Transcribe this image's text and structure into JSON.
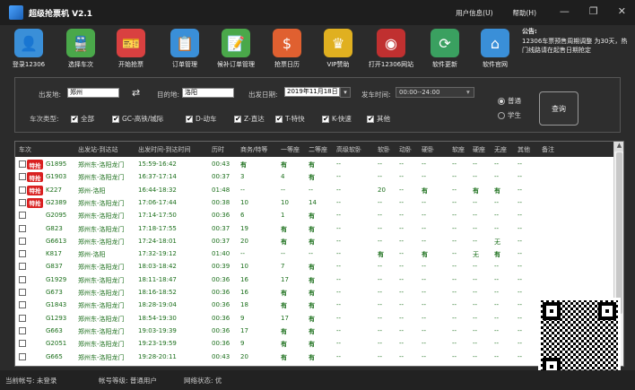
{
  "app": {
    "title": "超级抢票机 V2.1",
    "menus": [
      "用户信息(U)",
      "帮助(H)"
    ],
    "win_buttons": [
      "—",
      "❐",
      "✕"
    ]
  },
  "toolbar": [
    {
      "label": "登录12306",
      "icon": "user-icon",
      "color": "#3a8fd8",
      "glyph": "👤"
    },
    {
      "label": "选择车次",
      "icon": "train-icon",
      "color": "#4aa84a",
      "glyph": "🚆"
    },
    {
      "label": "开始抢票",
      "icon": "ticket-icon",
      "color": "#d94040",
      "glyph": "🎫"
    },
    {
      "label": "订单管理",
      "icon": "order-icon",
      "color": "#3a8fd8",
      "glyph": "📋"
    },
    {
      "label": "候补订单管理",
      "icon": "waitlist-icon",
      "color": "#4aa84a",
      "glyph": "📝"
    },
    {
      "label": "抢票日历",
      "icon": "calendar-icon",
      "color": "#e06030",
      "glyph": "$"
    },
    {
      "label": "VIP赞助",
      "icon": "vip-icon",
      "color": "#e0b020",
      "glyph": "♛"
    },
    {
      "label": "打开12306网站",
      "icon": "railway-logo-icon",
      "color": "#c03030",
      "glyph": "◉"
    },
    {
      "label": "软件更新",
      "icon": "refresh-icon",
      "color": "#3aa060",
      "glyph": "⟳"
    },
    {
      "label": "软件官网",
      "icon": "home-icon",
      "color": "#3a8fd8",
      "glyph": "⌂"
    }
  ],
  "notice": {
    "title": "公告:",
    "text": "12306车票预售周期调整 为30天，热门线路请在起售日期抢定"
  },
  "filter": {
    "from_label": "出发地:",
    "from_value": "郑州",
    "swap_glyph": "⇄",
    "to_label": "目的地:",
    "to_value": "洛阳",
    "date_label": "出发日期:",
    "date_value": "2019年11月18日",
    "time_label": "发车时间:",
    "time_value": "00:00--24:00",
    "type_label": "车次类型:",
    "types": [
      {
        "label": "全部",
        "checked": true
      },
      {
        "label": "GC-高铁/城际",
        "checked": true
      },
      {
        "label": "D-动车",
        "checked": true
      },
      {
        "label": "Z-直达",
        "checked": true
      },
      {
        "label": "T-特快",
        "checked": true
      },
      {
        "label": "K-快速",
        "checked": true
      },
      {
        "label": "其他",
        "checked": true
      }
    ],
    "passenger_types": [
      {
        "label": "普通",
        "checked": true
      },
      {
        "label": "学生",
        "checked": false
      }
    ],
    "query_label": "查询"
  },
  "table": {
    "headers": [
      "车次",
      "出发站-到达站",
      "出发时间-到达时间",
      "历时",
      "商务/特等",
      "一等座",
      "二等座",
      "高级软卧",
      "软卧",
      "动卧",
      "硬卧",
      "软座",
      "硬座",
      "无座",
      "其他",
      "备注"
    ],
    "badge_label": "特抢",
    "rows": [
      {
        "train": "G1895",
        "badge": true,
        "stations": "郑州东-洛阳龙门",
        "times": "15:59-16:42",
        "duration": "00:43",
        "c": [
          "有",
          "有",
          "有",
          "--",
          "--",
          "--",
          "--",
          "--",
          "--",
          "--",
          "--"
        ]
      },
      {
        "train": "G1903",
        "badge": true,
        "stations": "郑州东-洛阳龙门",
        "times": "16:37-17:14",
        "duration": "00:37",
        "c": [
          "3",
          "4",
          "有",
          "--",
          "--",
          "--",
          "--",
          "--",
          "--",
          "--",
          "--"
        ]
      },
      {
        "train": "K227",
        "badge": true,
        "stations": "郑州-洛阳",
        "times": "16:44-18:32",
        "duration": "01:48",
        "c": [
          "--",
          "--",
          "--",
          "--",
          "20",
          "--",
          "有",
          "--",
          "有",
          "有",
          "--"
        ]
      },
      {
        "train": "G2389",
        "badge": true,
        "stations": "郑州东-洛阳龙门",
        "times": "17:06-17:44",
        "duration": "00:38",
        "c": [
          "10",
          "10",
          "14",
          "--",
          "--",
          "--",
          "--",
          "--",
          "--",
          "--",
          "--"
        ]
      },
      {
        "train": "G2095",
        "badge": false,
        "stations": "郑州东-洛阳龙门",
        "times": "17:14-17:50",
        "duration": "00:36",
        "c": [
          "6",
          "1",
          "有",
          "--",
          "--",
          "--",
          "--",
          "--",
          "--",
          "--",
          "--"
        ]
      },
      {
        "train": "G823",
        "badge": false,
        "stations": "郑州东-洛阳龙门",
        "times": "17:18-17:55",
        "duration": "00:37",
        "c": [
          "19",
          "有",
          "有",
          "--",
          "--",
          "--",
          "--",
          "--",
          "--",
          "--",
          "--"
        ]
      },
      {
        "train": "G6613",
        "badge": false,
        "stations": "郑州东-洛阳龙门",
        "times": "17:24-18:01",
        "duration": "00:37",
        "c": [
          "20",
          "有",
          "有",
          "--",
          "--",
          "--",
          "--",
          "--",
          "--",
          "无",
          "--"
        ]
      },
      {
        "train": "K817",
        "badge": false,
        "stations": "郑州-洛阳",
        "times": "17:32-19:12",
        "duration": "01:40",
        "c": [
          "--",
          "--",
          "--",
          "--",
          "有",
          "--",
          "有",
          "--",
          "无",
          "有",
          "--"
        ]
      },
      {
        "train": "G837",
        "badge": false,
        "stations": "郑州东-洛阳龙门",
        "times": "18:03-18:42",
        "duration": "00:39",
        "c": [
          "10",
          "7",
          "有",
          "--",
          "--",
          "--",
          "--",
          "--",
          "--",
          "--",
          "--"
        ]
      },
      {
        "train": "G1929",
        "badge": false,
        "stations": "郑州东-洛阳龙门",
        "times": "18:11-18:47",
        "duration": "00:36",
        "c": [
          "16",
          "17",
          "有",
          "--",
          "--",
          "--",
          "--",
          "--",
          "--",
          "--",
          "--"
        ]
      },
      {
        "train": "G673",
        "badge": false,
        "stations": "郑州东-洛阳龙门",
        "times": "18:16-18:52",
        "duration": "00:36",
        "c": [
          "16",
          "有",
          "有",
          "--",
          "--",
          "--",
          "--",
          "--",
          "--",
          "--",
          "--"
        ]
      },
      {
        "train": "G1843",
        "badge": false,
        "stations": "郑州东-洛阳龙门",
        "times": "18:28-19:04",
        "duration": "00:36",
        "c": [
          "18",
          "有",
          "有",
          "--",
          "--",
          "--",
          "--",
          "--",
          "--",
          "--",
          "--"
        ]
      },
      {
        "train": "G1293",
        "badge": false,
        "stations": "郑州东-洛阳龙门",
        "times": "18:54-19:30",
        "duration": "00:36",
        "c": [
          "9",
          "17",
          "有",
          "--",
          "--",
          "--",
          "--",
          "--",
          "--",
          "--",
          "--"
        ]
      },
      {
        "train": "G663",
        "badge": false,
        "stations": "郑州东-洛阳龙门",
        "times": "19:03-19:39",
        "duration": "00:36",
        "c": [
          "17",
          "有",
          "有",
          "--",
          "--",
          "--",
          "--",
          "--",
          "--",
          "--",
          "--"
        ]
      },
      {
        "train": "G2051",
        "badge": false,
        "stations": "郑州东-洛阳龙门",
        "times": "19:23-19:59",
        "duration": "00:36",
        "c": [
          "9",
          "有",
          "有",
          "--",
          "--",
          "--",
          "--",
          "--",
          "--",
          "--",
          "--"
        ]
      },
      {
        "train": "G665",
        "badge": false,
        "stations": "郑州东-洛阳龙门",
        "times": "19:28-20:11",
        "duration": "00:43",
        "c": [
          "20",
          "有",
          "有",
          "--",
          "--",
          "--",
          "--",
          "--",
          "--",
          "--",
          "--"
        ]
      }
    ]
  },
  "status": {
    "account": "当前帐号: 未登录",
    "level": "帐号等级: 普通用户",
    "network": "网络状态: 优"
  }
}
